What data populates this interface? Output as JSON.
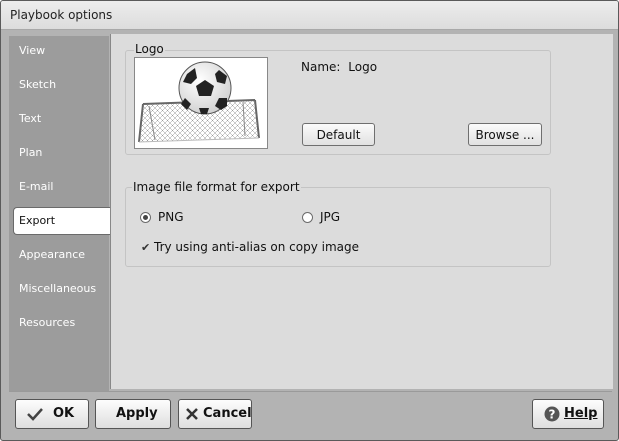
{
  "window": {
    "title": "Playbook options"
  },
  "sidebar": {
    "items": [
      {
        "label": "View"
      },
      {
        "label": "Sketch"
      },
      {
        "label": "Text"
      },
      {
        "label": "Plan"
      },
      {
        "label": "E-mail"
      },
      {
        "label": "Export",
        "selected": true
      },
      {
        "label": "Appearance"
      },
      {
        "label": "Miscellaneous"
      },
      {
        "label": "Resources"
      }
    ]
  },
  "logo_group": {
    "title": "Logo",
    "name_label": "Name:",
    "name_value": "Logo",
    "default_button": "Default",
    "browse_button": "Browse ..."
  },
  "export_group": {
    "title": "Image file format for export",
    "png_label": "PNG",
    "png_selected": true,
    "jpg_label": "JPG",
    "jpg_selected": false,
    "antialias_label": "Try using anti-alias on copy image",
    "antialias_checked": true
  },
  "footer": {
    "ok_label": "OK",
    "apply_label": "Apply",
    "cancel_label": "Cancel",
    "help_label": "Help"
  }
}
